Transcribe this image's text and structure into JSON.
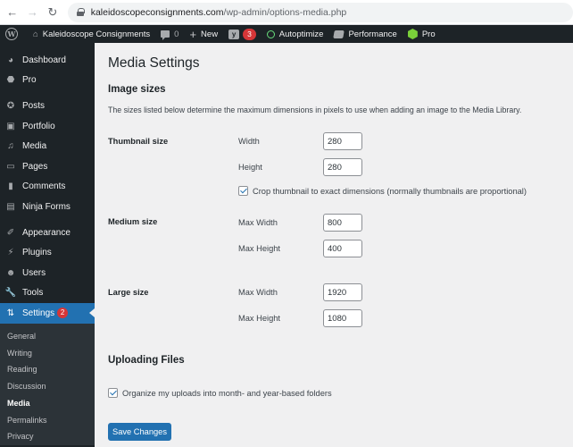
{
  "browser": {
    "url_domain": "kaleidoscopeconsignments.com",
    "url_path": "/wp-admin/options-media.php",
    "back_icon": "arrow-left-icon",
    "forward_icon": "arrow-right-icon",
    "reload_icon": "reload-icon"
  },
  "admin_bar": {
    "site_name": "Kaleidoscope Consignments",
    "comments_count": "0",
    "new_label": "New",
    "yoast_badge": "3",
    "autoptimize_label": "Autoptimize",
    "performance_label": "Performance",
    "pro_label": "Pro"
  },
  "sidebar": {
    "items": [
      {
        "label": "Dashboard",
        "icon": "dashboard-icon"
      },
      {
        "label": "Pro",
        "icon": "pro-icon"
      },
      {
        "label": "Posts",
        "icon": "pin-icon"
      },
      {
        "label": "Portfolio",
        "icon": "portfolio-icon"
      },
      {
        "label": "Media",
        "icon": "media-icon"
      },
      {
        "label": "Pages",
        "icon": "pages-icon"
      },
      {
        "label": "Comments",
        "icon": "comment-icon"
      },
      {
        "label": "Ninja Forms",
        "icon": "forms-icon"
      },
      {
        "label": "Appearance",
        "icon": "brush-icon"
      },
      {
        "label": "Plugins",
        "icon": "plugin-icon"
      },
      {
        "label": "Users",
        "icon": "user-icon"
      },
      {
        "label": "Tools",
        "icon": "wrench-icon"
      },
      {
        "label": "Settings",
        "icon": "settings-icon",
        "badge": "2",
        "active": true
      }
    ],
    "submenu": [
      "General",
      "Writing",
      "Reading",
      "Discussion",
      "Media",
      "Permalinks",
      "Privacy"
    ],
    "submenu_current": "Media"
  },
  "page": {
    "title": "Media Settings",
    "image_sizes_heading": "Image sizes",
    "description": "The sizes listed below determine the maximum dimensions in pixels to use when adding an image to the Media Library.",
    "thumbnail": {
      "label": "Thumbnail size",
      "width_label": "Width",
      "width_value": "280",
      "height_label": "Height",
      "height_value": "280",
      "crop_label": "Crop thumbnail to exact dimensions (normally thumbnails are proportional)",
      "crop_checked": true
    },
    "medium": {
      "label": "Medium size",
      "width_label": "Max Width",
      "width_value": "800",
      "height_label": "Max Height",
      "height_value": "400"
    },
    "large": {
      "label": "Large size",
      "width_label": "Max Width",
      "width_value": "1920",
      "height_label": "Max Height",
      "height_value": "1080"
    },
    "uploading_heading": "Uploading Files",
    "organize_label": "Organize my uploads into month- and year-based folders",
    "organize_checked": true,
    "save_label": "Save Changes"
  },
  "colors": {
    "accent": "#2271b1",
    "admin_bar_bg": "#1d2327",
    "badge": "#d63638",
    "content_bg": "#f0f0f1"
  }
}
